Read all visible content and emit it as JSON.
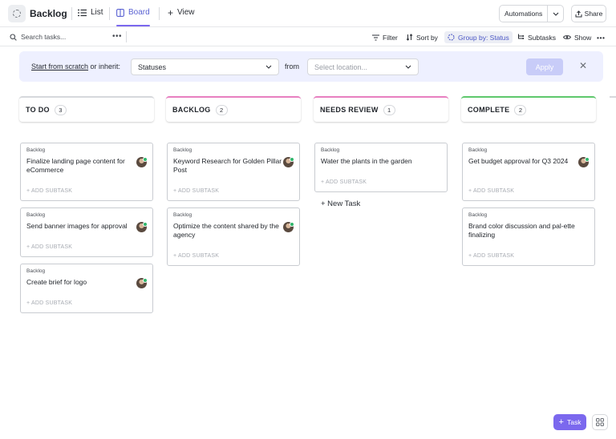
{
  "header": {
    "title": "Backlog",
    "tabs": [
      {
        "label": "List"
      },
      {
        "label": "Board"
      },
      {
        "label": "View"
      }
    ],
    "automations_label": "Automations",
    "share_label": "Share"
  },
  "toolbar": {
    "search_placeholder": "Search tasks...",
    "filter_label": "Filter",
    "sort_label": "Sort by",
    "group_label": "Group by: Status",
    "subtasks_label": "Subtasks",
    "show_label": "Show"
  },
  "banner": {
    "lead_link": "Start from scratch",
    "lead_rest": " or inherit:",
    "statuses_value": "Statuses",
    "from_label": "from",
    "location_placeholder": "Select location...",
    "apply_label": "Apply"
  },
  "colors": {
    "todo": "#d6d8dc",
    "backlog": "#e87fc0",
    "needs_review": "#e87fc0",
    "complete": "#5ec86c",
    "accent": "#7b68ee"
  },
  "columns": [
    {
      "name": "TO DO",
      "count": "3",
      "cards": [
        {
          "list": "Backlog",
          "title": "Finalize landing page content for eCommerce",
          "subtask": "+ ADD SUBTASK"
        },
        {
          "list": "Backlog",
          "title": "Send banner images for approval",
          "subtask": "+ ADD SUBTASK"
        },
        {
          "list": "Backlog",
          "title": "Create brief for logo",
          "subtask": "+ ADD SUBTASK"
        }
      ]
    },
    {
      "name": "BACKLOG",
      "count": "2",
      "cards": [
        {
          "list": "Backlog",
          "title": "Keyword Research for Golden Pillar Post",
          "subtask": "+ ADD SUBTASK"
        },
        {
          "list": "Backlog",
          "title": "Optimize the content shared by the agency",
          "subtask": "+ ADD SUBTASK"
        }
      ]
    },
    {
      "name": "NEEDS REVIEW",
      "count": "1",
      "cards": [
        {
          "list": "Backlog",
          "title": "Water the plants in the garden",
          "subtask": "+ ADD SUBTASK"
        }
      ],
      "new_task_label": "+ New Task"
    },
    {
      "name": "COMPLETE",
      "count": "2",
      "cards": [
        {
          "list": "Backlog",
          "title": "Get budget approval for Q3 2024",
          "subtask": "+ ADD SUBTASK"
        },
        {
          "list": "Backlog",
          "title": "Brand color discussion and pal-ette finalizing",
          "subtask": "+ ADD SUBTASK"
        }
      ]
    }
  ],
  "fab_label": "Task"
}
